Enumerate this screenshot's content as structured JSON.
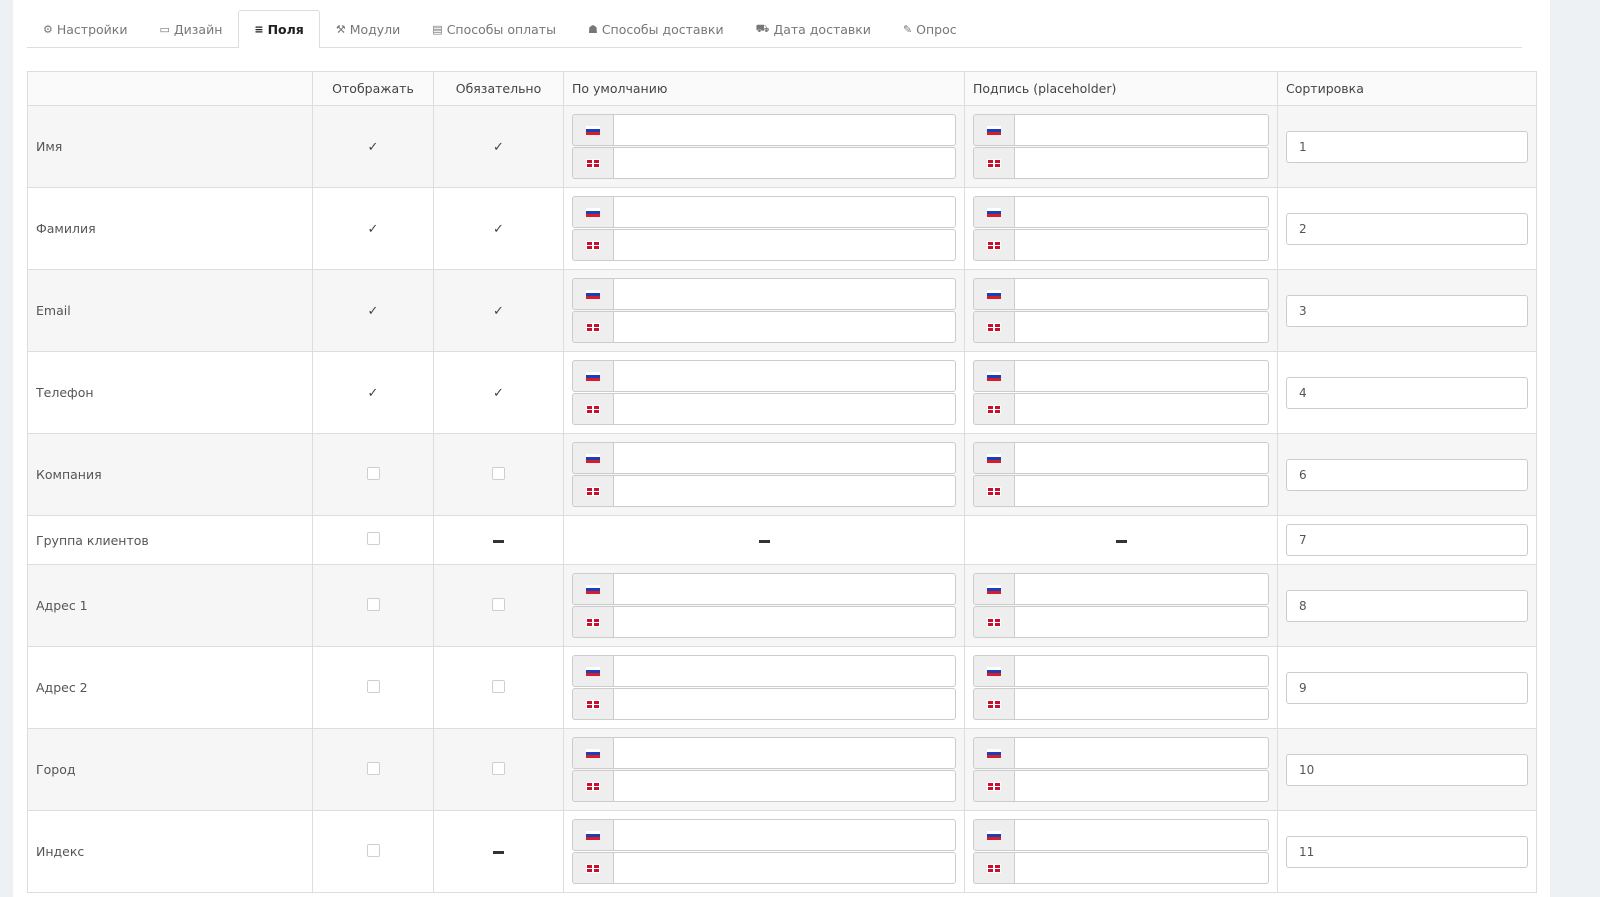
{
  "tabs": [
    {
      "icon": "⚙",
      "icon_name": "gear-icon",
      "label": "Настройки",
      "active": false
    },
    {
      "icon": "▭",
      "icon_name": "monitor-icon",
      "label": "Дизайн",
      "active": false
    },
    {
      "icon": "≡",
      "icon_name": "list-icon",
      "label": "Поля",
      "active": true
    },
    {
      "icon": "⚒",
      "icon_name": "modules-icon",
      "label": "Модули",
      "active": false
    },
    {
      "icon": "▤",
      "icon_name": "credit-card-icon",
      "label": "Способы оплаты",
      "active": false
    },
    {
      "icon": "☗",
      "icon_name": "delivery-person-icon",
      "label": "Способы доставки",
      "active": false
    },
    {
      "icon": "⛟",
      "icon_name": "truck-icon",
      "label": "Дата доставки",
      "active": false
    },
    {
      "icon": "✎",
      "icon_name": "edit-icon",
      "label": "Опрос",
      "active": false
    }
  ],
  "table": {
    "headers": [
      "",
      "Отображать",
      "Обязательно",
      "По умолчанию",
      "Подпись (placeholder)",
      "Сортировка"
    ],
    "rows": [
      {
        "name": "Имя",
        "show": "checked",
        "required": "checked",
        "inputs": true,
        "sort": "1"
      },
      {
        "name": "Фамилия",
        "show": "checked",
        "required": "checked",
        "inputs": true,
        "sort": "2"
      },
      {
        "name": "Email",
        "show": "checked",
        "required": "checked",
        "inputs": true,
        "sort": "3"
      },
      {
        "name": "Телефон",
        "show": "checked",
        "required": "checked",
        "inputs": true,
        "sort": "4"
      },
      {
        "name": "Компания",
        "show": "unchecked",
        "required": "unchecked",
        "inputs": true,
        "sort": "6"
      },
      {
        "name": "Группа клиентов",
        "show": "unchecked",
        "required": "dash",
        "inputs": false,
        "sort": "7"
      },
      {
        "name": "Адрес 1",
        "show": "unchecked",
        "required": "unchecked",
        "inputs": true,
        "sort": "8"
      },
      {
        "name": "Адрес 2",
        "show": "unchecked",
        "required": "unchecked",
        "inputs": true,
        "sort": "9"
      },
      {
        "name": "Город",
        "show": "unchecked",
        "required": "unchecked",
        "inputs": true,
        "sort": "10"
      },
      {
        "name": "Индекс",
        "show": "unchecked",
        "required": "dash",
        "inputs": true,
        "sort": "11"
      }
    ]
  },
  "languages": [
    "ru-flag-icon",
    "en-flag-icon"
  ],
  "colors": {
    "flag_ru": [
      "#ffffff",
      "#1c3fb8",
      "#d21f2b"
    ],
    "flag_en": "#c8102e"
  }
}
